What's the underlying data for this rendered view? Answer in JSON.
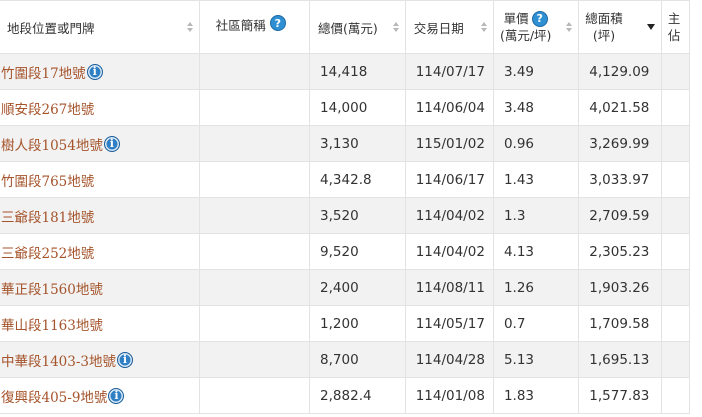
{
  "headers": {
    "location": "地段位置或門牌",
    "community": "社區簡稱",
    "total_price": "總價(萬元)",
    "trade_date": "交易日期",
    "unit_price_top": "單價",
    "unit_price_bottom": "(萬元/坪)",
    "total_area_top": "總面積",
    "total_area_bottom": "(坪)",
    "extra_top": "主",
    "extra_bottom": "佔"
  },
  "icons": {
    "help": "?",
    "info": "i"
  },
  "rows": [
    {
      "location": "竹圍段17地號",
      "info": true,
      "community": "",
      "total_price": "14,418",
      "date": "114/07/17",
      "unit_price": "3.49",
      "area": "4,129.09"
    },
    {
      "location": "順安段267地號",
      "info": false,
      "community": "",
      "total_price": "14,000",
      "date": "114/06/04",
      "unit_price": "3.48",
      "area": "4,021.58"
    },
    {
      "location": "樹人段1054地號",
      "info": true,
      "community": "",
      "total_price": "3,130",
      "date": "115/01/02",
      "unit_price": "0.96",
      "area": "3,269.99"
    },
    {
      "location": "竹圍段765地號",
      "info": false,
      "community": "",
      "total_price": "4,342.8",
      "date": "114/06/17",
      "unit_price": "1.43",
      "area": "3,033.97"
    },
    {
      "location": "三爺段181地號",
      "info": false,
      "community": "",
      "total_price": "3,520",
      "date": "114/04/02",
      "unit_price": "1.3",
      "area": "2,709.59"
    },
    {
      "location": "三爺段252地號",
      "info": false,
      "community": "",
      "total_price": "9,520",
      "date": "114/04/02",
      "unit_price": "4.13",
      "area": "2,305.23"
    },
    {
      "location": "華正段1560地號",
      "info": false,
      "community": "",
      "total_price": "2,400",
      "date": "114/08/11",
      "unit_price": "1.26",
      "area": "1,903.26"
    },
    {
      "location": "華山段1163地號",
      "info": false,
      "community": "",
      "total_price": "1,200",
      "date": "114/05/17",
      "unit_price": "0.7",
      "area": "1,709.58"
    },
    {
      "location": "中華段1403-3地號",
      "info": true,
      "community": "",
      "total_price": "8,700",
      "date": "114/04/28",
      "unit_price": "5.13",
      "area": "1,695.13"
    },
    {
      "location": "復興段405-9地號",
      "info": true,
      "community": "",
      "total_price": "2,882.4",
      "date": "114/01/08",
      "unit_price": "1.83",
      "area": "1,577.83"
    }
  ]
}
